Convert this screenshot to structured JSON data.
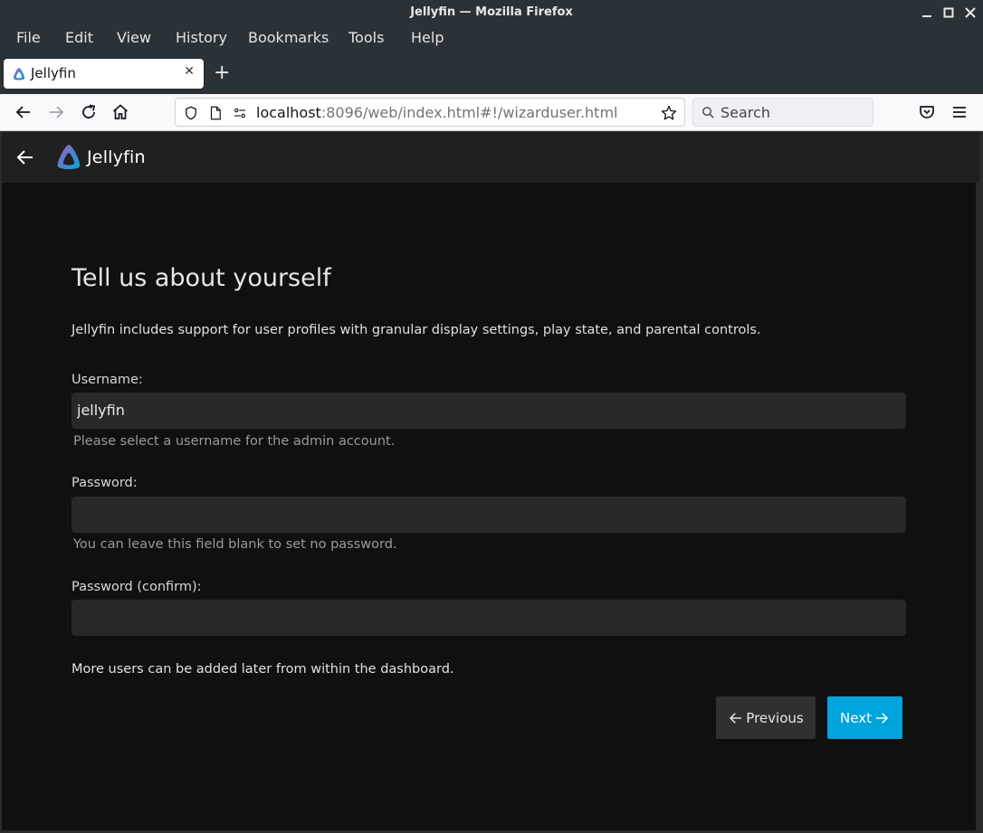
{
  "window": {
    "title": "Jellyfin — Mozilla Firefox"
  },
  "menubar": {
    "items": [
      "File",
      "Edit",
      "View",
      "History",
      "Bookmarks",
      "Tools",
      "Help"
    ]
  },
  "tabs": [
    {
      "label": "Jellyfin",
      "active": true
    }
  ],
  "urlbar": {
    "host": "localhost",
    "rest": ":8096/web/index.html#!/wizarduser.html"
  },
  "searchbar": {
    "placeholder": "Search"
  },
  "app": {
    "name": "Jellyfin"
  },
  "wizard": {
    "title": "Tell us about yourself",
    "intro": "Jellyfin includes support for user profiles with granular display settings, play state, and parental controls.",
    "username": {
      "label": "Username:",
      "value": "jellyfin",
      "help": "Please select a username for the admin account."
    },
    "password": {
      "label": "Password:",
      "value": "",
      "help": "You can leave this field blank to set no password."
    },
    "password_confirm": {
      "label": "Password (confirm):",
      "value": ""
    },
    "footer_note": "More users can be added later from within the dashboard.",
    "previous_label": "Previous",
    "next_label": "Next"
  },
  "colors": {
    "accent": "#00a4dc",
    "background": "#101010",
    "header": "#202020",
    "input": "#292929"
  }
}
